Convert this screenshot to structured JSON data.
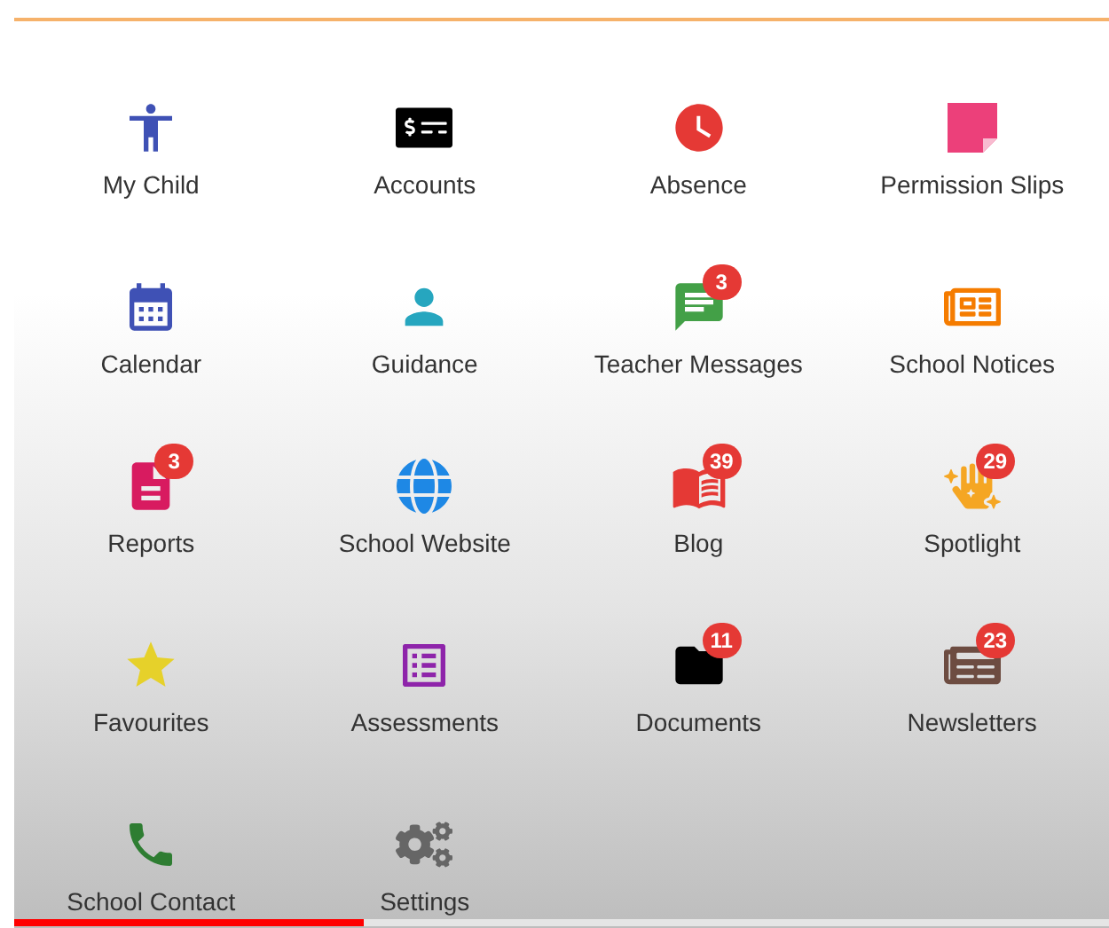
{
  "tiles": [
    {
      "kind": "child",
      "label": "My Child"
    },
    {
      "kind": "accounts",
      "label": "Accounts"
    },
    {
      "kind": "absence",
      "label": "Absence"
    },
    {
      "kind": "permission",
      "label": "Permission Slips"
    },
    {
      "kind": "calendar",
      "label": "Calendar"
    },
    {
      "kind": "guidance",
      "label": "Guidance"
    },
    {
      "kind": "messages",
      "label": "Teacher Messages",
      "badge": "3"
    },
    {
      "kind": "notices",
      "label": "School Notices"
    },
    {
      "kind": "reports",
      "label": "Reports",
      "badge": "3"
    },
    {
      "kind": "website",
      "label": "School Website"
    },
    {
      "kind": "blog",
      "label": "Blog",
      "badge": "39"
    },
    {
      "kind": "spotlight",
      "label": "Spotlight",
      "badge": "29"
    },
    {
      "kind": "favourites",
      "label": "Favourites"
    },
    {
      "kind": "assessments",
      "label": "Assessments"
    },
    {
      "kind": "documents",
      "label": "Documents",
      "badge": "11"
    },
    {
      "kind": "newsletters",
      "label": "Newsletters",
      "badge": "23"
    },
    {
      "kind": "contact",
      "label": "School Contact"
    },
    {
      "kind": "settings",
      "label": "Settings"
    }
  ],
  "video_progress": {
    "level": 0.32
  }
}
